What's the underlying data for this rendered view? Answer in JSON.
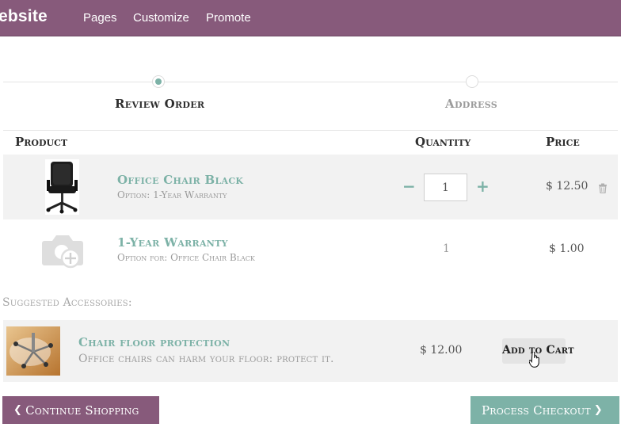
{
  "nav": {
    "brand": "ebsite",
    "menu": [
      "Pages",
      "Customize",
      "Promote"
    ]
  },
  "wizard": {
    "steps": [
      {
        "label": "Review Order",
        "active": true
      },
      {
        "label": "Address",
        "active": false
      }
    ]
  },
  "cart": {
    "headers": {
      "product": "Product",
      "quantity": "Quantity",
      "price": "Price"
    },
    "items": [
      {
        "name": "Office Chair Black",
        "option": "Option: 1-Year Warranty",
        "quantity": "1",
        "price": "$ 12.50",
        "icon": "office-chair-image"
      },
      {
        "name": "1-Year Warranty",
        "option": "Option for: Office Chair Black",
        "quantity": "1",
        "price": "$ 1.00",
        "icon": "camera-placeholder-icon"
      }
    ]
  },
  "accessories": {
    "title": "Suggested Accessories:",
    "items": [
      {
        "name": "Chair floor protection",
        "description": "Office chairs can harm your floor: protect it.",
        "price": "$ 12.00",
        "add_label": "Add to Cart"
      }
    ]
  },
  "actions": {
    "continue_label": "Continue Shopping",
    "checkout_label": "Process Checkout"
  },
  "colors": {
    "navbar": "#875a7b",
    "accent": "#7db2a7",
    "continue_button": "#875a7b",
    "checkout_button": "#7db2a7"
  }
}
